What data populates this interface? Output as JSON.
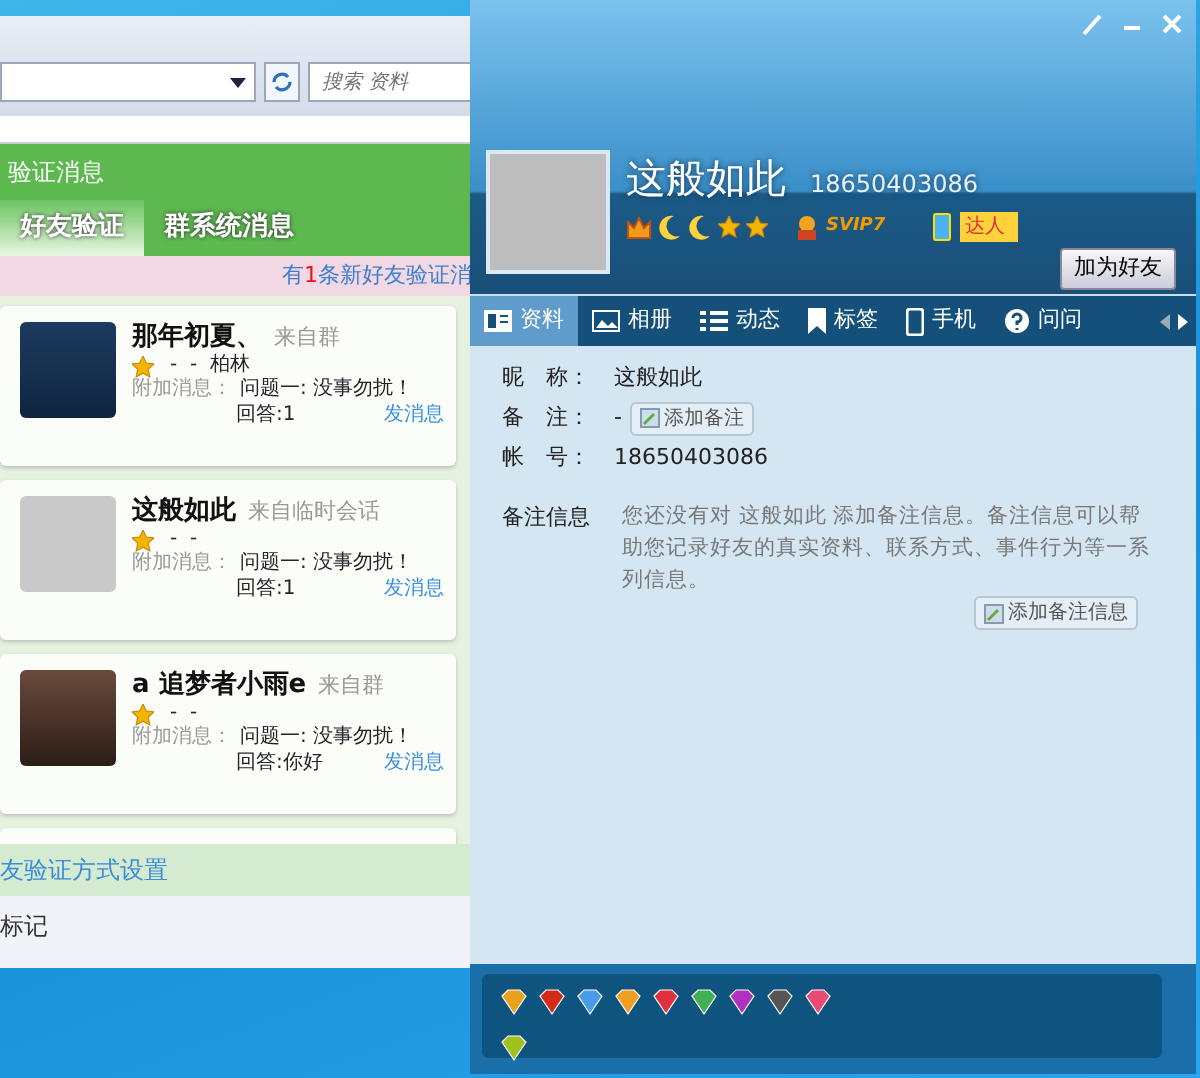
{
  "search": {
    "placeholder": "搜索 资料"
  },
  "verify_window": {
    "title": "验证消息",
    "tabs": [
      {
        "label": "好友验证",
        "selected": true
      },
      {
        "label": "群系统消息",
        "selected": false
      }
    ],
    "notice": {
      "before": "有",
      "count": "1",
      "after": "条新好友验证消"
    },
    "requests": [
      {
        "name": "那年初夏、",
        "source": "来自群",
        "level_text": "-  -  柏林",
        "extra_label": "附加消息：",
        "question": "问题一: 没事勿扰！",
        "answer": "回答:1",
        "action": "发消息"
      },
      {
        "name": "这般如此",
        "source": "来自临时会话",
        "level_text": "-  -",
        "extra_label": "附加消息：",
        "question": "问题一: 没事勿扰！",
        "answer": "回答:1",
        "action": "发消息"
      },
      {
        "name": "a 追梦者小雨e",
        "source": "来自群",
        "level_text": "-  -",
        "extra_label": "附加消息：",
        "question": "问题一: 没事勿扰！",
        "answer": "回答:你好",
        "action": "发消息"
      }
    ],
    "settings_link": "友验证方式设置",
    "bottom_text": "标记"
  },
  "profile": {
    "name": "这般如此",
    "number": "18650403086",
    "vip": "SVIP7",
    "talent": "达人",
    "add_button": "加为好友",
    "tabs": [
      {
        "label": "资料",
        "selected": true
      },
      {
        "label": "相册",
        "selected": false
      },
      {
        "label": "动态",
        "selected": false
      },
      {
        "label": "标签",
        "selected": false
      },
      {
        "label": "手机",
        "selected": false
      },
      {
        "label": "问问",
        "selected": false
      }
    ],
    "fields": [
      {
        "label": "昵　称：",
        "value": "这般如此"
      },
      {
        "label": "备　注：",
        "value": "-",
        "action": "添加备注"
      },
      {
        "label": "帐　号：",
        "value": "18650403086"
      }
    ],
    "note": {
      "label": "备注信息",
      "text": "您还没有对 这般如此 添加备注信息。备注信息可以帮助您记录好友的真实资料、联系方式、事件行为等一系列信息。",
      "action": "添加备注信息"
    }
  }
}
